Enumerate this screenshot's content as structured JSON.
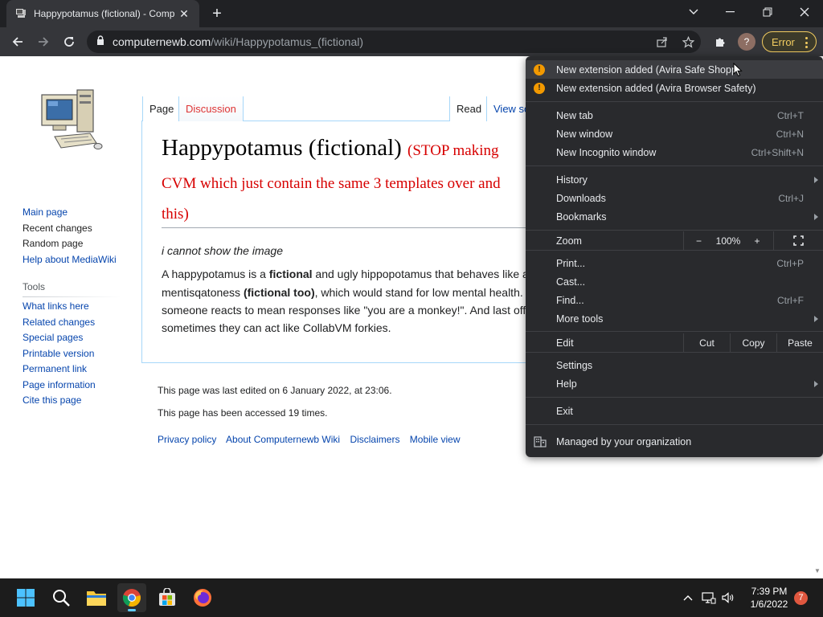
{
  "browser": {
    "tab_title": "Happypotamus (fictional) - Comp",
    "url_host": "computernewb.com",
    "url_path": "/wiki/Happypotamus_(fictional)",
    "error_label": "Error",
    "profile_initial": "?"
  },
  "wiki": {
    "tabs": {
      "page": "Page",
      "discussion": "Discussion",
      "read": "Read",
      "view_source": "View so"
    },
    "title": "Happypotamus (fictional)",
    "title_note_1": "(STOP making",
    "title_note_2": "CVM which just contain the same 3 templates over and",
    "title_note_3": "this)",
    "image_caption": "i cannot show the image",
    "body": {
      "l1_a": "A happypotamus is a ",
      "l1_b": "fictional",
      "l1_c": " and ugly hippopotamus that behaves like a",
      "l2_a": "mentisqatoness ",
      "l2_b": "(fictional too)",
      "l2_c": ", which would stand for low mental health.",
      "l3": "someone reacts to mean responses like \"you are a monkey!\". And last off",
      "l4": "sometimes they can act like CollabVM forkies."
    },
    "nav": [
      "Main page",
      "Recent changes",
      "Random page",
      "Help about MediaWiki"
    ],
    "tools_heading": "Tools",
    "tools": [
      "What links here",
      "Related changes",
      "Special pages",
      "Printable version",
      "Permanent link",
      "Page information",
      "Cite this page"
    ],
    "last_edited": "This page was last edited on 6 January 2022, at 23:06.",
    "accessed": "This page has been accessed 19 times.",
    "footer_links": [
      "Privacy policy",
      "About Computernewb Wiki",
      "Disclaimers",
      "Mobile view"
    ]
  },
  "menu": {
    "ext1": "New extension added (Avira Safe Shopping)",
    "ext2": "New extension added (Avira Browser Safety)",
    "new_tab": {
      "label": "New tab",
      "shortcut": "Ctrl+T"
    },
    "new_window": {
      "label": "New window",
      "shortcut": "Ctrl+N"
    },
    "new_incognito": {
      "label": "New Incognito window",
      "shortcut": "Ctrl+Shift+N"
    },
    "history": "History",
    "downloads": {
      "label": "Downloads",
      "shortcut": "Ctrl+J"
    },
    "bookmarks": "Bookmarks",
    "zoom": {
      "label": "Zoom",
      "minus": "−",
      "level": "100%",
      "plus": "+"
    },
    "print": {
      "label": "Print...",
      "shortcut": "Ctrl+P"
    },
    "cast": "Cast...",
    "find": {
      "label": "Find...",
      "shortcut": "Ctrl+F"
    },
    "more_tools": "More tools",
    "edit": {
      "label": "Edit",
      "cut": "Cut",
      "copy": "Copy",
      "paste": "Paste"
    },
    "settings": "Settings",
    "help": "Help",
    "exit": "Exit",
    "managed": "Managed by your organization"
  },
  "taskbar": {
    "time": "7:39 PM",
    "date": "1/6/2022",
    "notification_count": "7"
  },
  "colors": {
    "accent_warning": "#f29900",
    "error_chip": "#f2cc60",
    "wiki_link": "#0645ad",
    "wiki_red": "#d70000"
  }
}
